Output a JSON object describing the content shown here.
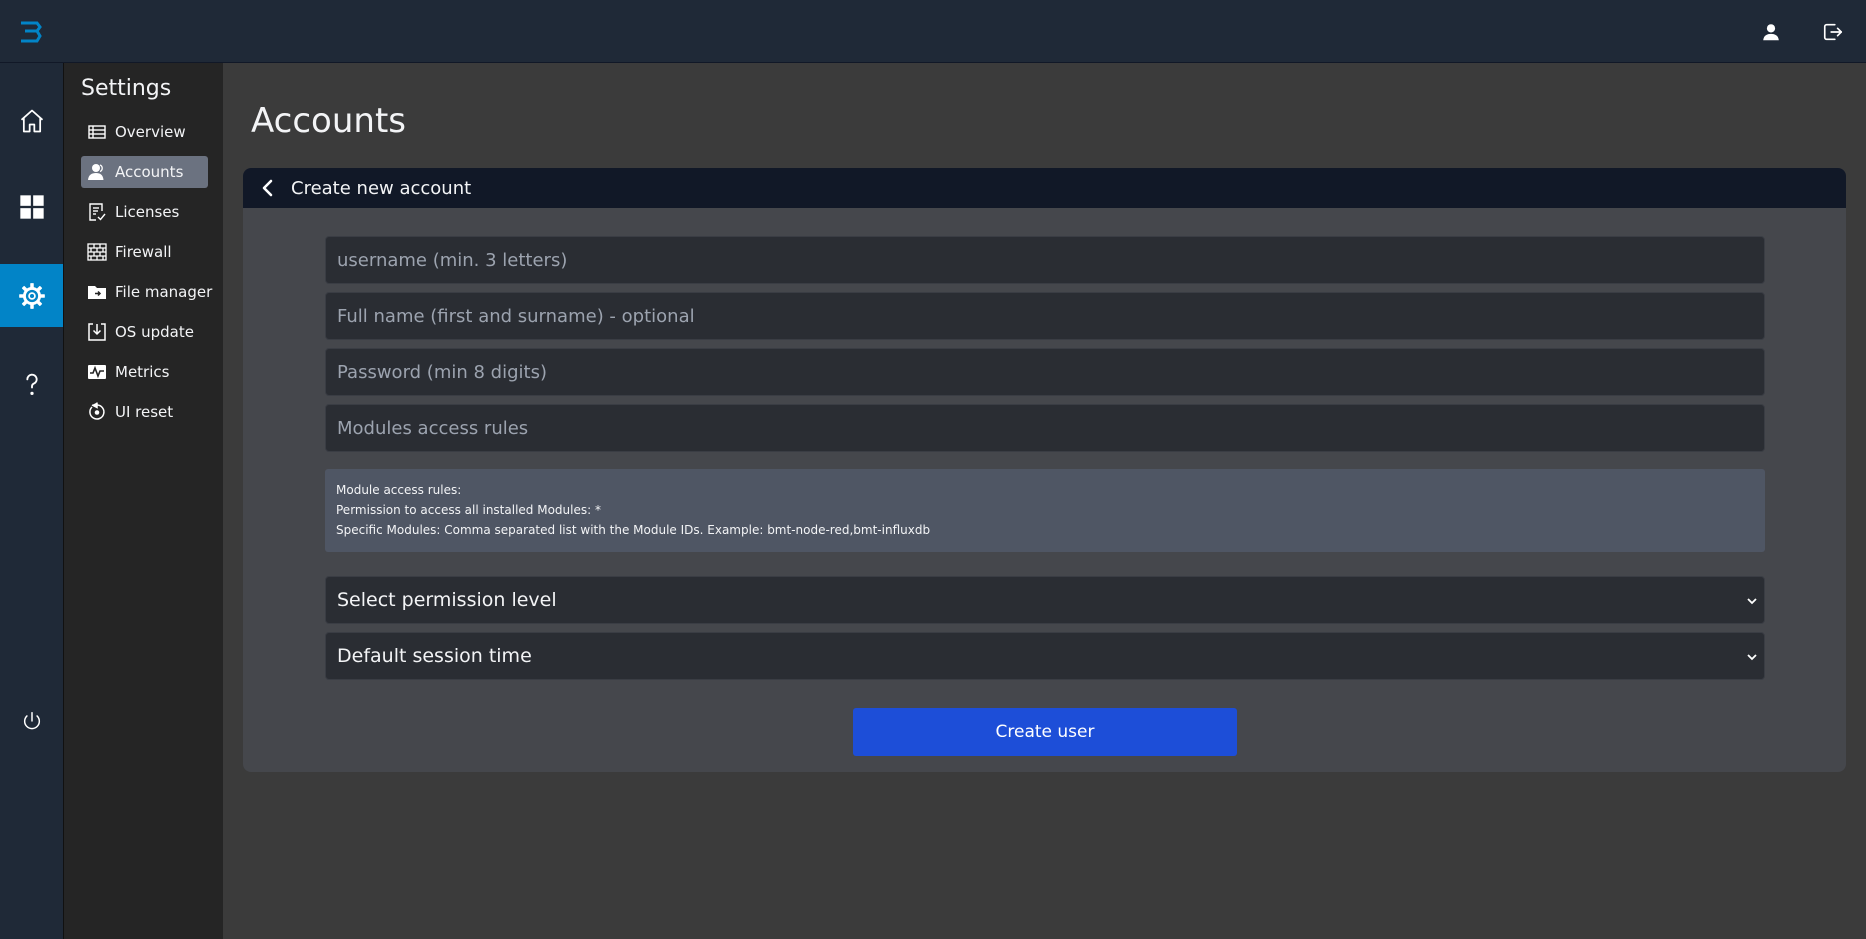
{
  "topbar": {
    "logo_icon": "brand-logo",
    "user_icon": "user-icon",
    "logout_icon": "logout-icon"
  },
  "rail": {
    "items": [
      {
        "icon": "home-icon",
        "active": false
      },
      {
        "icon": "dashboard-icon",
        "active": false
      },
      {
        "icon": "gear-icon",
        "active": true
      },
      {
        "icon": "help-icon",
        "active": false
      },
      {
        "icon": "power-icon",
        "active": false
      }
    ],
    "accent": "#0284c7"
  },
  "subnav": {
    "title": "Settings",
    "items": [
      {
        "label": "Overview",
        "icon": "list-icon",
        "active": false
      },
      {
        "label": "Accounts",
        "icon": "users-icon",
        "active": true
      },
      {
        "label": "Licenses",
        "icon": "license-icon",
        "active": false
      },
      {
        "label": "Firewall",
        "icon": "firewall-icon",
        "active": false
      },
      {
        "label": "File manager",
        "icon": "folder-icon",
        "active": false
      },
      {
        "label": "OS update",
        "icon": "download-icon",
        "active": false
      },
      {
        "label": "Metrics",
        "icon": "pulse-icon",
        "active": false
      },
      {
        "label": "UI reset",
        "icon": "reset-icon",
        "active": false
      }
    ]
  },
  "page": {
    "title": "Accounts"
  },
  "form": {
    "header_title": "Create new account",
    "username_placeholder": "username (min. 3 letters)",
    "fullname_placeholder": "Full name (first and surname) - optional",
    "password_placeholder": "Password (min 8 digits)",
    "modules_placeholder": "Modules access rules",
    "info_lines": [
      "Module access rules:",
      "Permission to access all installed Modules: *",
      "Specific Modules: Comma separated list with the Module IDs. Example: bmt-node-red,bmt-influxdb"
    ],
    "permission_select": "Select permission level",
    "session_select": "Default session time",
    "submit_label": "Create user",
    "submit_color": "#1d4ed8"
  }
}
